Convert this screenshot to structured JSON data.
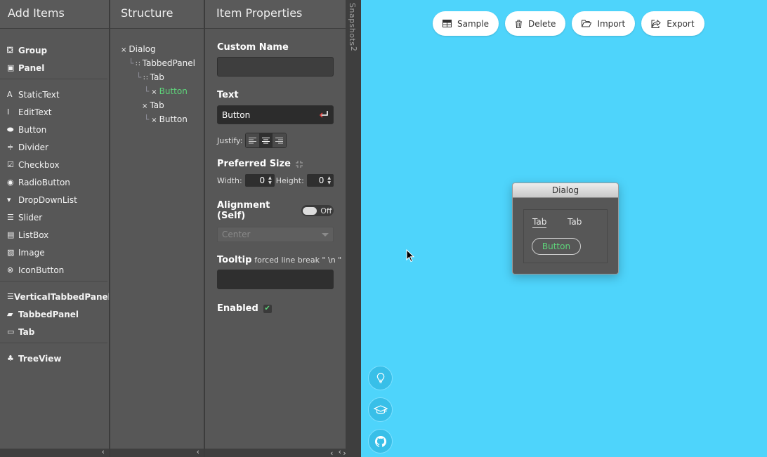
{
  "add_items": {
    "title": "Add Items",
    "groups": [
      [
        {
          "label": "Group",
          "icon": "group-icon",
          "glyph": "⛋",
          "bold": true
        },
        {
          "label": "Panel",
          "icon": "panel-icon",
          "glyph": "▣",
          "bold": true
        }
      ],
      [
        {
          "label": "StaticText",
          "icon": "static-text-icon",
          "glyph": "A",
          "bold": false
        },
        {
          "label": "EditText",
          "icon": "edit-text-icon",
          "glyph": "I",
          "bold": false
        },
        {
          "label": "Button",
          "icon": "button-icon",
          "glyph": "⬬",
          "bold": false
        },
        {
          "label": "Divider",
          "icon": "divider-icon",
          "glyph": "≑",
          "bold": false
        },
        {
          "label": "Checkbox",
          "icon": "checkbox-icon",
          "glyph": "☑",
          "bold": false
        },
        {
          "label": "RadioButton",
          "icon": "radio-button-icon",
          "glyph": "◉",
          "bold": false
        },
        {
          "label": "DropDownList",
          "icon": "dropdown-icon",
          "glyph": "▾",
          "bold": false
        },
        {
          "label": "Slider",
          "icon": "slider-icon",
          "glyph": "☰",
          "bold": false
        },
        {
          "label": "ListBox",
          "icon": "listbox-icon",
          "glyph": "▤",
          "bold": false
        },
        {
          "label": "Image",
          "icon": "image-icon",
          "glyph": "▨",
          "bold": false
        },
        {
          "label": "IconButton",
          "icon": "icon-button-icon",
          "glyph": "⊗",
          "bold": false
        }
      ],
      [
        {
          "label": "VerticalTabbedPanel",
          "icon": "vertical-tabbed-panel-icon",
          "glyph": "☰",
          "bold": true
        },
        {
          "label": "TabbedPanel",
          "icon": "tabbed-panel-icon",
          "glyph": "▰",
          "bold": true
        },
        {
          "label": "Tab",
          "icon": "tab-icon",
          "glyph": "▭",
          "bold": true
        }
      ],
      [
        {
          "label": "TreeView",
          "icon": "tree-view-icon",
          "glyph": "♣",
          "bold": true
        }
      ]
    ]
  },
  "structure": {
    "title": "Structure",
    "nodes": [
      {
        "label": "Dialog",
        "depth": 0,
        "prefix": "×",
        "conn": "",
        "highlight": false
      },
      {
        "label": "TabbedPanel",
        "depth": 1,
        "prefix": "∷",
        "conn": "└",
        "highlight": false
      },
      {
        "label": "Tab",
        "depth": 2,
        "prefix": "∷",
        "conn": "└",
        "highlight": false
      },
      {
        "label": "Button",
        "depth": 3,
        "prefix": "×",
        "conn": "└",
        "highlight": true
      },
      {
        "label": "Tab",
        "depth": 2,
        "prefix": "×",
        "conn": "",
        "highlight": false
      },
      {
        "label": "Button",
        "depth": 3,
        "prefix": "×",
        "conn": "└",
        "highlight": false
      }
    ]
  },
  "properties": {
    "title": "Item Properties",
    "custom_name_label": "Custom Name",
    "custom_name_value": "",
    "text_label": "Text",
    "text_value": "Button",
    "justify_label": "Justify:",
    "preferred_size_label": "Preferred Size",
    "width_label": "Width:",
    "width_value": "0",
    "height_label": "Height:",
    "height_value": "0",
    "alignment_label": "Alignment (Self)",
    "alignment_toggle": "Off",
    "alignment_value": "Center",
    "tooltip_label": "Tooltip",
    "tooltip_hint": "forced line break \" \\n \"",
    "tooltip_value": "",
    "enabled_label": "Enabled",
    "enabled_check": "✔"
  },
  "snapshots": {
    "label": "Snapshots",
    "count": "2"
  },
  "toolbar": {
    "sample": "Sample",
    "delete": "Delete",
    "import": "Import",
    "export": "Export"
  },
  "dialog": {
    "title": "Dialog",
    "tab1": "Tab",
    "tab2": "Tab",
    "button": "Button"
  },
  "colors": {
    "canvas": "#4ed4fb",
    "panel": "#575757",
    "highlight": "#5ed47a"
  }
}
